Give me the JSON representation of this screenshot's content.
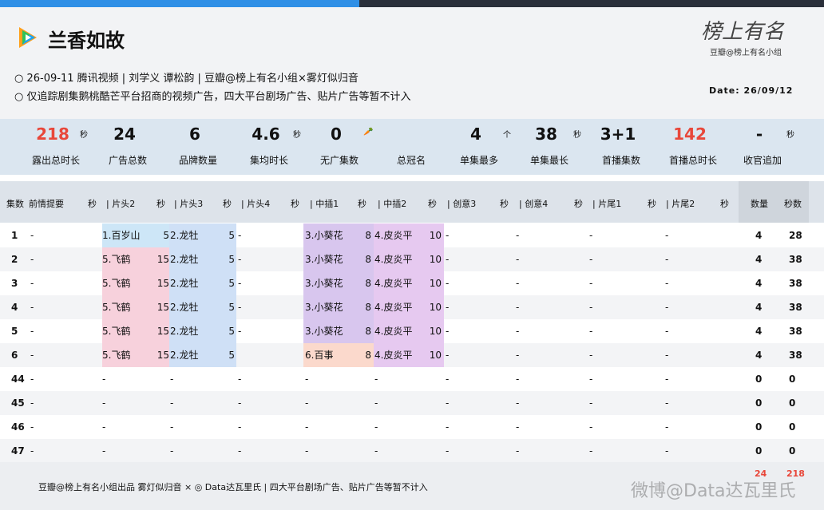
{
  "header": {
    "title": "兰香如故",
    "brand_sign": "榜上有名",
    "brand_sub": "豆瓣@榜上有名小组",
    "meta_line1": "○ 26-09-11 腾讯视频 | 刘学义 谭松韵 | 豆瓣@榜上有名小组×雾灯似归音",
    "meta_line2": "○ 仅追踪剧集鹅桃酷芒平台招商的视频广告，四大平台剧场广告、贴片广告等暂不计入",
    "date": "Date: 26/09/12"
  },
  "stats": [
    {
      "value": "218",
      "unit": "秒",
      "label": "露出总时长",
      "red": true
    },
    {
      "value": "24",
      "unit": "",
      "label": "广告总数",
      "red": false
    },
    {
      "value": "6",
      "unit": "",
      "label": "品牌数量",
      "red": false
    },
    {
      "value": "4.6",
      "unit": "秒",
      "label": "集均时长",
      "red": false
    },
    {
      "value": "0",
      "unit": "🥕",
      "label": "无广集数",
      "red": false
    },
    {
      "value": "",
      "unit": "",
      "label": "总冠名",
      "red": false
    },
    {
      "value": "4",
      "unit": "个",
      "label": "单集最多",
      "red": false
    },
    {
      "value": "38",
      "unit": "秒",
      "label": "单集最长",
      "red": false
    },
    {
      "value": "3+1",
      "unit": "",
      "label": "首播集数",
      "red": false
    },
    {
      "value": "142",
      "unit": "",
      "label": "首播总时长",
      "red": true
    },
    {
      "value": "-",
      "unit": "秒",
      "label": "收官追加",
      "red": false
    }
  ],
  "table_headers": [
    "集数",
    "前情提要",
    "秒",
    "| 片头2",
    "秒",
    "| 片头3",
    "秒",
    "| 片头4",
    "秒",
    "| 中插1",
    "秒",
    "| 中插2",
    "秒",
    "| 创意3",
    "秒",
    "| 创意4",
    "秒",
    "| 片尾1",
    "秒",
    "| 片尾2",
    "秒",
    "数量",
    "秒数"
  ],
  "rows": [
    {
      "ep": "1",
      "recap": "-",
      "h2": "1.百岁山",
      "h2s": "5",
      "h3": "2.龙牡",
      "h3s": "5",
      "h4": "-",
      "m1": "3.小葵花",
      "m1s": "8",
      "m2": "4.皮炎平",
      "m2s": "10",
      "c3": "-",
      "c4": "-",
      "e1": "-",
      "e2": "-",
      "count": "4",
      "secs": "28"
    },
    {
      "ep": "2",
      "recap": "-",
      "h2": "5.飞鹤",
      "h2s": "15",
      "h3": "2.龙牡",
      "h3s": "5",
      "h4": "-",
      "m1": "3.小葵花",
      "m1s": "8",
      "m2": "4.皮炎平",
      "m2s": "10",
      "c3": "-",
      "c4": "-",
      "e1": "-",
      "e2": "-",
      "count": "4",
      "secs": "38"
    },
    {
      "ep": "3",
      "recap": "-",
      "h2": "5.飞鹤",
      "h2s": "15",
      "h3": "2.龙牡",
      "h3s": "5",
      "h4": "-",
      "m1": "3.小葵花",
      "m1s": "8",
      "m2": "4.皮炎平",
      "m2s": "10",
      "c3": "-",
      "c4": "-",
      "e1": "-",
      "e2": "-",
      "count": "4",
      "secs": "38"
    },
    {
      "ep": "4",
      "recap": "-",
      "h2": "5.飞鹤",
      "h2s": "15",
      "h3": "2.龙牡",
      "h3s": "5",
      "h4": "-",
      "m1": "3.小葵花",
      "m1s": "8",
      "m2": "4.皮炎平",
      "m2s": "10",
      "c3": "-",
      "c4": "-",
      "e1": "-",
      "e2": "-",
      "count": "4",
      "secs": "38"
    },
    {
      "ep": "5",
      "recap": "-",
      "h2": "5.飞鹤",
      "h2s": "15",
      "h3": "2.龙牡",
      "h3s": "5",
      "h4": "-",
      "m1": "3.小葵花",
      "m1s": "8",
      "m2": "4.皮炎平",
      "m2s": "10",
      "c3": "-",
      "c4": "-",
      "e1": "-",
      "e2": "-",
      "count": "4",
      "secs": "38"
    },
    {
      "ep": "6",
      "recap": "-",
      "h2": "5.飞鹤",
      "h2s": "15",
      "h3": "2.龙牡",
      "h3s": "5",
      "h4": "",
      "m1": "6.百事",
      "m1s": "8",
      "m2": "4.皮炎平",
      "m2s": "10",
      "c3": "-",
      "c4": "-",
      "e1": "-",
      "e2": "-",
      "count": "4",
      "secs": "38"
    },
    {
      "ep": "44",
      "recap": "-",
      "h2": "-",
      "h2s": "",
      "h3": "-",
      "h3s": "",
      "h4": "-",
      "m1": "-",
      "m1s": "",
      "m2": "-",
      "m2s": "",
      "c3": "-",
      "c4": "-",
      "e1": "-",
      "e2": "-",
      "count": "0",
      "secs": "0"
    },
    {
      "ep": "45",
      "recap": "-",
      "h2": "-",
      "h2s": "",
      "h3": "-",
      "h3s": "",
      "h4": "-",
      "m1": "-",
      "m1s": "",
      "m2": "-",
      "m2s": "",
      "c3": "-",
      "c4": "-",
      "e1": "-",
      "e2": "-",
      "count": "0",
      "secs": "0"
    },
    {
      "ep": "46",
      "recap": "-",
      "h2": "-",
      "h2s": "",
      "h3": "-",
      "h3s": "",
      "h4": "-",
      "m1": "-",
      "m1s": "",
      "m2": "-",
      "m2s": "",
      "c3": "-",
      "c4": "-",
      "e1": "-",
      "e2": "-",
      "count": "0",
      "secs": "0"
    },
    {
      "ep": "47",
      "recap": "-",
      "h2": "-",
      "h2s": "",
      "h3": "-",
      "h3s": "",
      "h4": "-",
      "m1": "-",
      "m1s": "",
      "m2": "-",
      "m2s": "",
      "c3": "-",
      "c4": "-",
      "e1": "-",
      "e2": "-",
      "count": "0",
      "secs": "0"
    }
  ],
  "footer": {
    "text": "豆瓣@榜上有名小组出品 雾灯似归音 × ◎ Data达瓦里氏 | 四大平台剧场广告、贴片广告等暂不计入",
    "sum_count": "24",
    "sum_secs": "218",
    "watermark": "微博@Data达瓦里氏"
  }
}
